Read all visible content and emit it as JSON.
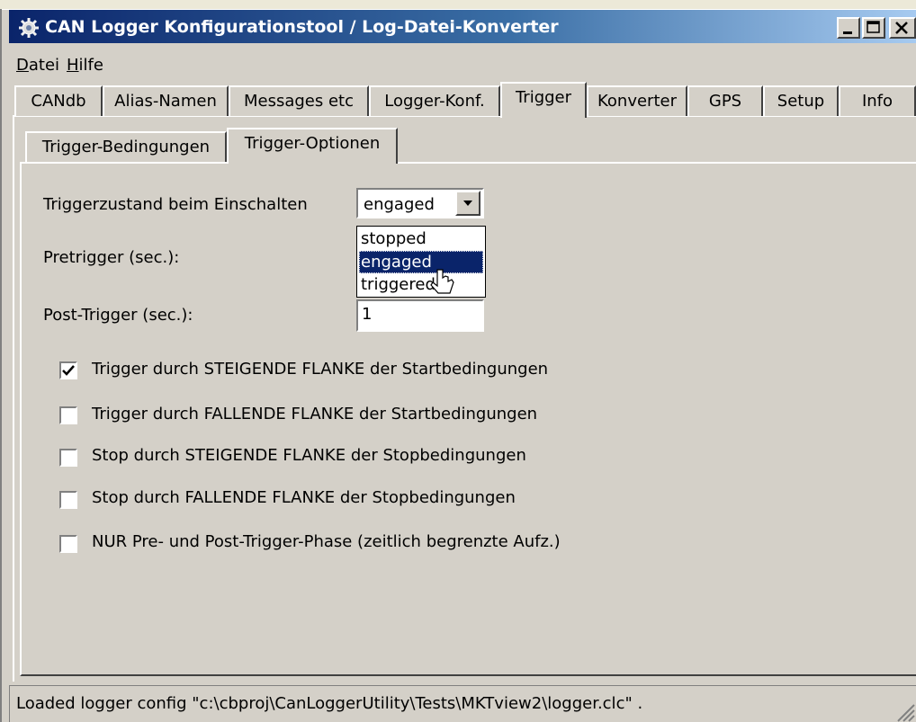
{
  "window": {
    "title": "CAN Logger Konfigurationstool / Log-Datei-Konverter"
  },
  "menu": [
    {
      "label": "Datei",
      "mnemonic": "D",
      "rest": "atei"
    },
    {
      "label": "Hilfe",
      "mnemonic": "H",
      "rest": "ilfe"
    }
  ],
  "tabs": [
    "CANdb",
    "Alias-Namen",
    "Messages etc",
    "Logger-Konf.",
    "Trigger",
    "Konverter",
    "GPS",
    "Setup",
    "Info"
  ],
  "active_tab": "Trigger",
  "subtabs": [
    "Trigger-Bedingungen",
    "Trigger-Optionen"
  ],
  "active_subtab": "Trigger-Optionen",
  "form": {
    "trigger_state_label": "Triggerzustand beim Einschalten",
    "trigger_state_value": "engaged",
    "trigger_state_options": [
      "stopped",
      "engaged",
      "triggered"
    ],
    "pretrigger_label": "Pretrigger (sec.):",
    "posttrigger_label": "Post-Trigger (sec.):",
    "posttrigger_value": "1"
  },
  "checkboxes": [
    {
      "label": "Trigger durch STEIGENDE FLANKE der Startbedingungen",
      "checked": true
    },
    {
      "label": "Trigger durch FALLENDE FLANKE der Startbedingungen",
      "checked": false
    },
    {
      "label": "Stop durch STEIGENDE FLANKE der Stopbedingungen",
      "checked": false
    },
    {
      "label": "Stop durch FALLENDE FLANKE der Stopbedingungen",
      "checked": false
    },
    {
      "label": "NUR Pre- und Post-Trigger-Phase (zeitlich begrenzte Aufz.)",
      "checked": false
    }
  ],
  "status": {
    "text": "Loaded logger config \"c:\\cbproj\\CanLoggerUtility\\Tests\\MKTview2\\logger.clc\" ."
  },
  "colors": {
    "titlebar_start": "#0a246a",
    "face": "#d4d0c8",
    "selection": "#0a246a"
  }
}
